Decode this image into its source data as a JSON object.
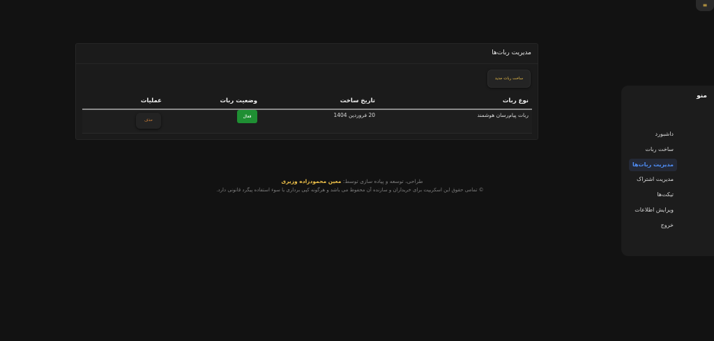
{
  "topbar": {
    "menu_icon": "≡"
  },
  "panel": {
    "title": "مدیریت ربات‌ها",
    "new_bot_button": "ساخت ربات جدید",
    "table": {
      "headers": {
        "type": "نوع ربات",
        "date": "تاریخ ساخت",
        "status": "وضعیت ربات",
        "ops": "عملیات"
      },
      "rows": [
        {
          "type": "ربات پیام‌رسان هوشمند",
          "date": "20 فروردین 1404",
          "status": "فعال",
          "delete": "حذف"
        }
      ]
    }
  },
  "footer": {
    "credit_prefix": "طراحی، توسعه و پیاده سازی توسط:",
    "author": "معین محمودزاده وزیری",
    "rights": "© تمامی حقوق این اسکریپت برای خریداران و سازنده آن محفوظ می باشد و هرگونه کپی برداری یا سوء استفاده پیگرد قانونی دارد."
  },
  "sidebar": {
    "title": "منو",
    "items": [
      "داشبورد",
      "ساخت ربات",
      "مدیریت ربات‌ها",
      "مدیریت اشتراک",
      "تیکت‌ها",
      "ویرایش اطلاعات",
      "خروج"
    ],
    "active_index": 2
  },
  "colors": {
    "accent": "#f0c24a",
    "active": "#4f8ef7",
    "success": "#1f8f33",
    "danger": "#e08a3a"
  }
}
